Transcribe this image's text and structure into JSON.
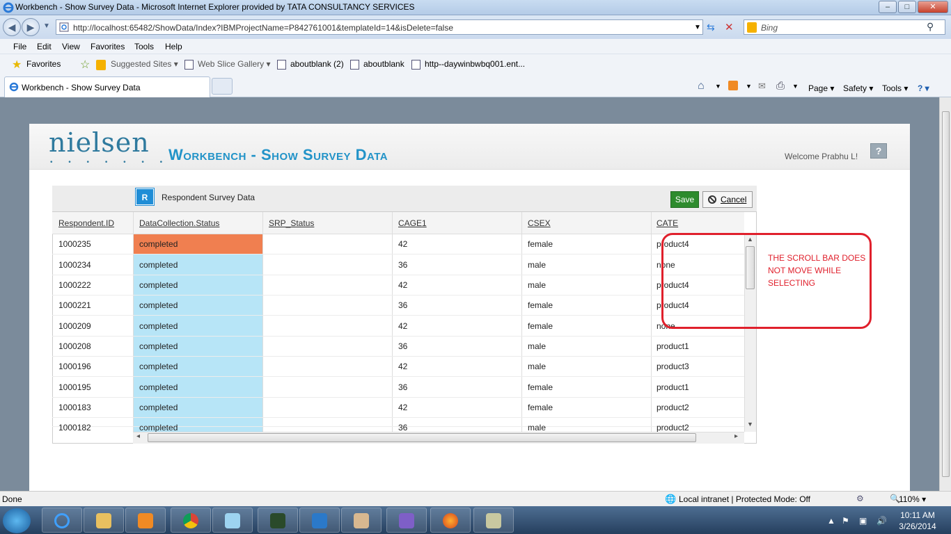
{
  "window": {
    "title": "Workbench - Show Survey Data - Microsoft Internet Explorer provided by TATA CONSULTANCY SERVICES",
    "min": "–",
    "max": "□",
    "close": "✕"
  },
  "address": {
    "url": "http://localhost:65482/ShowData/Index?IBMProjectName=P842761001&templateId=14&isDelete=false",
    "search_placeholder": "Bing"
  },
  "menu": [
    "File",
    "Edit",
    "View",
    "Favorites",
    "Tools",
    "Help"
  ],
  "favorites_bar": {
    "favorites": "Favorites",
    "items": [
      "Suggested Sites ▾",
      "Web Slice Gallery ▾",
      "aboutblank (2)",
      "aboutblank",
      "http--daywinbwbq001.ent..."
    ]
  },
  "tab": {
    "title": "Workbench - Show Survey Data"
  },
  "command_bar": {
    "page": "Page ▾",
    "safety": "Safety ▾",
    "tools": "Tools ▾",
    "help": "? ▾"
  },
  "app": {
    "logo": "nielsen",
    "logo_dots": "• • • • • • •",
    "title": "Workbench - Show Survey Data",
    "welcome": "Welcome Prabhu L!",
    "help": "?"
  },
  "grid": {
    "badge": "R",
    "title": "Respondent Survey Data",
    "save": "Save",
    "cancel": "Cancel",
    "columns": [
      "Respondent.ID",
      "DataCollection.Status",
      "SRP_Status",
      "CAGE1",
      "CSEX",
      "CATE"
    ],
    "rows": [
      [
        "1000235",
        "completed",
        "",
        "42",
        "female",
        "product4"
      ],
      [
        "1000234",
        "completed",
        "",
        "36",
        "male",
        "none"
      ],
      [
        "1000222",
        "completed",
        "",
        "42",
        "male",
        "product4"
      ],
      [
        "1000221",
        "completed",
        "",
        "36",
        "female",
        "product4"
      ],
      [
        "1000209",
        "completed",
        "",
        "42",
        "female",
        "none"
      ],
      [
        "1000208",
        "completed",
        "",
        "36",
        "male",
        "product1"
      ],
      [
        "1000196",
        "completed",
        "",
        "42",
        "male",
        "product3"
      ],
      [
        "1000195",
        "completed",
        "",
        "36",
        "female",
        "product1"
      ],
      [
        "1000183",
        "completed",
        "",
        "42",
        "female",
        "product2"
      ],
      [
        "1000182",
        "completed",
        "",
        "36",
        "male",
        "product2"
      ]
    ],
    "selected_cell_color": "#f07f50",
    "status_column_color": "#b7e5f7"
  },
  "annotation": {
    "text": "THE SCROLL BAR DOES NOT MOVE WHILE SELECTING",
    "color": "#e0202c"
  },
  "status": {
    "left": "Done",
    "zone": "Local intranet | Protected Mode: Off",
    "zoom": "110% ▾"
  },
  "taskbar": {
    "time": "10:11 AM",
    "date": "3/26/2014"
  }
}
